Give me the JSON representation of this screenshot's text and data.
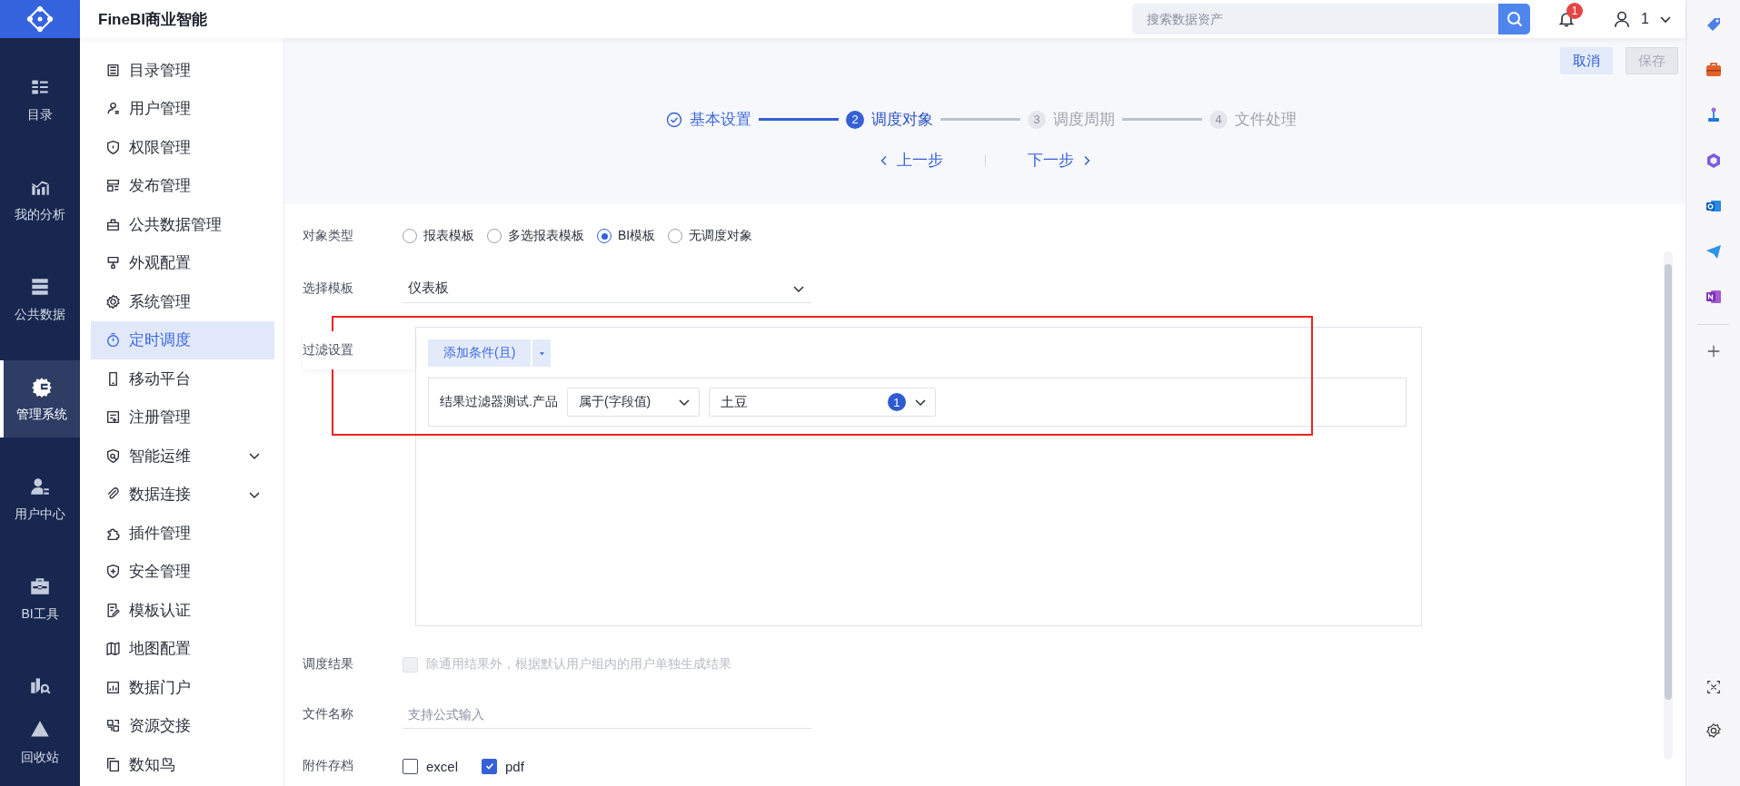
{
  "rail": {
    "items": [
      {
        "label": "目录",
        "selected": false
      },
      {
        "label": "我的分析",
        "selected": false
      },
      {
        "label": "公共数据",
        "selected": false
      },
      {
        "label": "管理系统",
        "selected": true
      },
      {
        "label": "用户中心",
        "selected": false
      },
      {
        "label": "BI工具",
        "selected": false
      },
      {
        "label": "回收站",
        "selected": false
      }
    ]
  },
  "header": {
    "title": "FineBI商业智能",
    "search": {
      "placeholder": "搜索数据资产"
    },
    "notifications": "1",
    "user": "1"
  },
  "sidebar": {
    "items": [
      {
        "label": "目录管理",
        "selected": false,
        "kind": "link"
      },
      {
        "label": "用户管理",
        "selected": false,
        "kind": "link"
      },
      {
        "label": "权限管理",
        "selected": false,
        "kind": "link"
      },
      {
        "label": "发布管理",
        "selected": false,
        "kind": "link"
      },
      {
        "label": "公共数据管理",
        "selected": false,
        "kind": "link"
      },
      {
        "label": "外观配置",
        "selected": false,
        "kind": "link"
      },
      {
        "label": "系统管理",
        "selected": false,
        "kind": "link"
      },
      {
        "label": "定时调度",
        "selected": true,
        "kind": "link"
      },
      {
        "label": "移动平台",
        "selected": false,
        "kind": "link"
      },
      {
        "label": "注册管理",
        "selected": false,
        "kind": "link"
      },
      {
        "label": "智能运维",
        "selected": false,
        "kind": "group"
      },
      {
        "label": "数据连接",
        "selected": false,
        "kind": "group"
      },
      {
        "label": "插件管理",
        "selected": false,
        "kind": "link"
      },
      {
        "label": "安全管理",
        "selected": false,
        "kind": "link"
      },
      {
        "label": "模板认证",
        "selected": false,
        "kind": "link"
      },
      {
        "label": "地图配置",
        "selected": false,
        "kind": "link"
      },
      {
        "label": "数据门户",
        "selected": false,
        "kind": "link"
      },
      {
        "label": "资源交接",
        "selected": false,
        "kind": "link"
      },
      {
        "label": "数知鸟",
        "selected": false,
        "kind": "link"
      }
    ]
  },
  "actions": [
    {
      "label": "取消",
      "disabled": false
    },
    {
      "label": "保存",
      "disabled": true
    }
  ],
  "steps": [
    {
      "label": "基本设置",
      "completed": true,
      "selected": false
    },
    {
      "number": "2",
      "label": "调度对象",
      "completed": false,
      "selected": true
    },
    {
      "number": "3",
      "label": "调度周期",
      "completed": false,
      "selected": false
    },
    {
      "number": "4",
      "label": "文件处理",
      "completed": false,
      "selected": false
    }
  ],
  "nav": {
    "prev": "上一步",
    "next": "下一步"
  },
  "form": {
    "object_type": {
      "label": "对象类型",
      "options": [
        {
          "label": "报表模板",
          "selected": false
        },
        {
          "label": "多选报表模板",
          "selected": false
        },
        {
          "label": "BI模板",
          "selected": true
        },
        {
          "label": "无调度对象",
          "selected": false
        }
      ]
    },
    "template": {
      "label": "选择模板",
      "value": "仪表板"
    },
    "filter": {
      "label": "过滤设置",
      "add_button": "添加条件(且)",
      "condition": {
        "field": "结果过滤器测试.产品",
        "operator": "属于(字段值)",
        "value": "土豆",
        "count": "1"
      }
    },
    "result": {
      "label": "调度结果",
      "option": {
        "label": "除通用结果外，根据默认用户组内的用户单独生成结果",
        "checked": false,
        "disabled": true
      }
    },
    "file_name": {
      "label": "文件名称",
      "placeholder": "支持公式输入"
    },
    "attachments": {
      "label": "附件存档",
      "options": [
        {
          "label": "excel",
          "checked": false
        },
        {
          "label": "pdf",
          "checked": true
        }
      ]
    }
  }
}
